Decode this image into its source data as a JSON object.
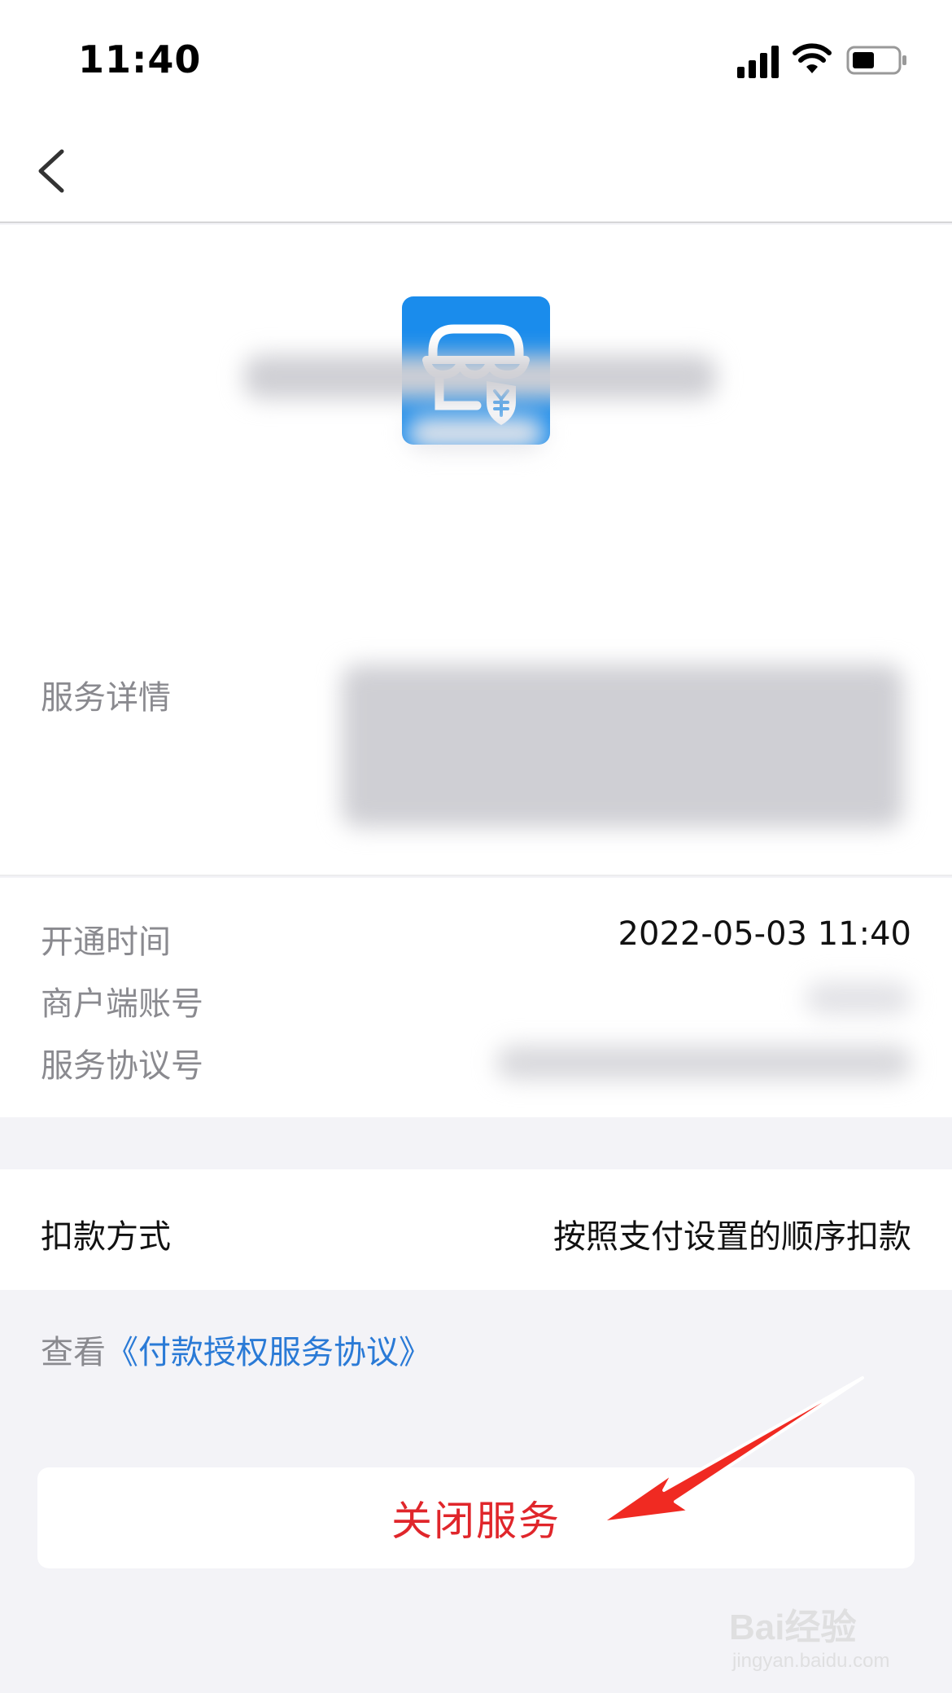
{
  "status_bar": {
    "time": "11:40"
  },
  "icons": {
    "back": "back-chevron-icon",
    "app_logo": "store-yuan-shield-icon",
    "signal": "cellular-signal-icon",
    "wifi": "wifi-icon",
    "battery": "battery-icon",
    "arrow": "red-arrow-annotation"
  },
  "colors": {
    "logo_blue": "#1a8cec",
    "link_blue": "#2a7ad6",
    "danger_red": "#e0262b"
  },
  "service": {
    "detail_label": "服务详情"
  },
  "info": {
    "rows": [
      {
        "label": "开通时间",
        "value": "2022-05-03 11:40"
      },
      {
        "label": "商户端账号",
        "value": ""
      },
      {
        "label": "服务协议号",
        "value": ""
      }
    ]
  },
  "deduction": {
    "label": "扣款方式",
    "value": "按照支付设置的顺序扣款"
  },
  "agreement": {
    "prefix": "查看",
    "link": "《付款授权服务协议》"
  },
  "close_button": {
    "label": "关闭服务"
  },
  "watermark": {
    "text": "Bai经验",
    "sub": "jingyan.baidu.com"
  }
}
